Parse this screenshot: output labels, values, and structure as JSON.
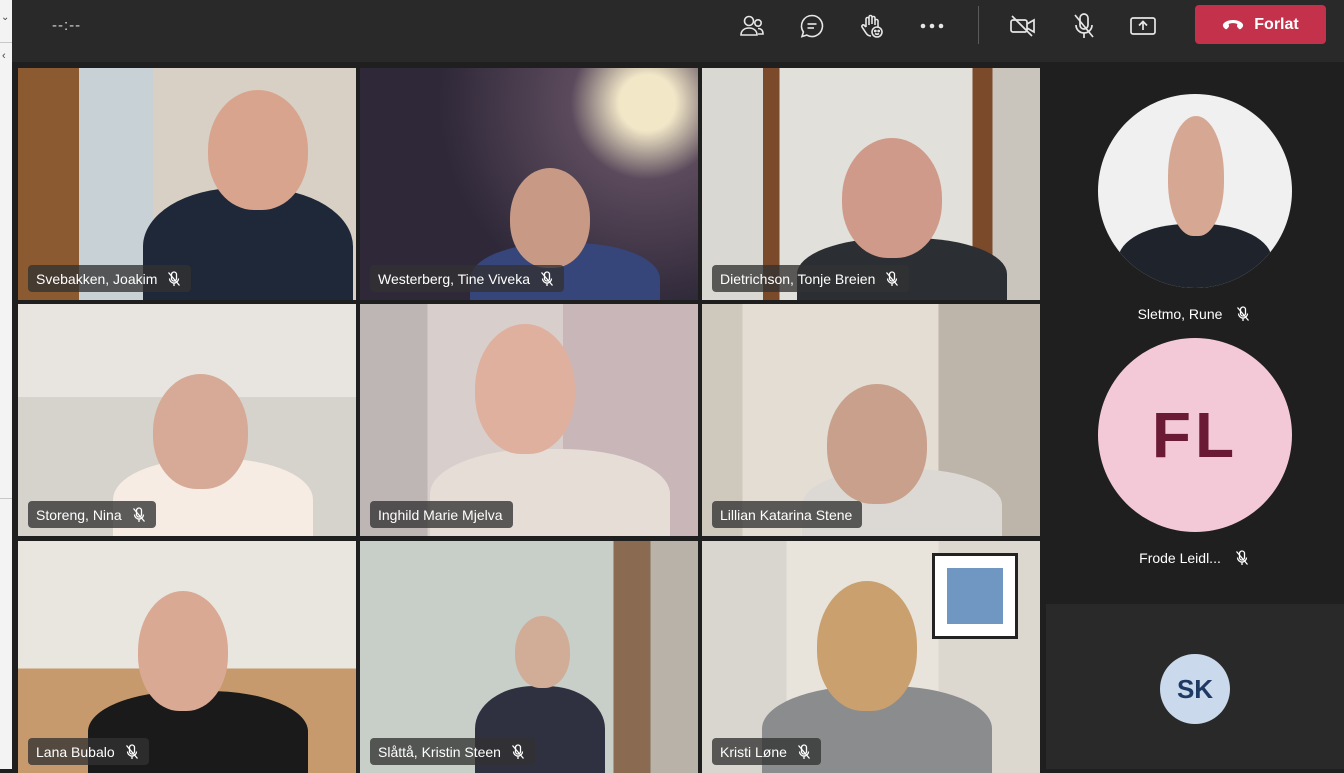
{
  "toolbar": {
    "timer": "--:--",
    "icons": [
      "participants-icon",
      "chat-icon",
      "raise-hand-icon",
      "more-options-icon",
      "camera-off-icon",
      "mic-off-icon",
      "share-screen-icon"
    ],
    "leave_label": "Forlat",
    "leave_color": "#c4314b"
  },
  "tiles": [
    {
      "name": "Svebakken, Joakim"
    },
    {
      "name": "Westerberg, Tine Viveka"
    },
    {
      "name": "Dietrichson, Tonje Breien"
    },
    {
      "name": "Storeng, Nina"
    },
    {
      "name": "Inghild Marie Mjelva",
      "speaking": true
    },
    {
      "name": "Lillian Katarina Stene"
    },
    {
      "name": "Lana Bubalo"
    },
    {
      "name": "Slåttå, Kristin Steen"
    },
    {
      "name": "Kristi Løne"
    }
  ],
  "side_panel": {
    "participants": [
      {
        "name": "Sletmo, Rune",
        "avatar": "photo"
      },
      {
        "name": "Frode Leidl...",
        "initials": "FL"
      },
      {
        "initials": "SK"
      }
    ]
  },
  "colors": {
    "speaking_border": "#7f85f5",
    "fl_avatar_bg": "#f4c9d7",
    "sk_avatar_bg": "#cad9ec"
  }
}
